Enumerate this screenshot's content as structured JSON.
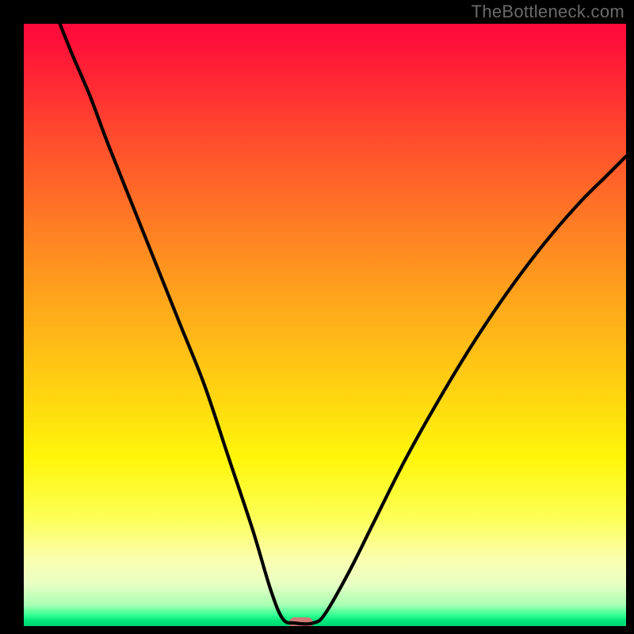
{
  "watermark": "TheBottleneck.com",
  "colors": {
    "frame": "#000000",
    "curve": "#000000",
    "marker": "#cf7a74",
    "gradient_stops": [
      {
        "pct": 0,
        "hex": "#ff0b3a"
      },
      {
        "pct": 3,
        "hex": "#ff1039"
      },
      {
        "pct": 18,
        "hex": "#ff482e"
      },
      {
        "pct": 32,
        "hex": "#ff7825"
      },
      {
        "pct": 45,
        "hex": "#ffa31c"
      },
      {
        "pct": 60,
        "hex": "#ffd012"
      },
      {
        "pct": 72,
        "hex": "#fff60a"
      },
      {
        "pct": 82,
        "hex": "#fdff56"
      },
      {
        "pct": 89,
        "hex": "#faffb0"
      },
      {
        "pct": 93,
        "hex": "#e9ffc3"
      },
      {
        "pct": 96.5,
        "hex": "#a8ffb3"
      },
      {
        "pct": 98.3,
        "hex": "#2cff90"
      },
      {
        "pct": 99.2,
        "hex": "#00e27a"
      },
      {
        "pct": 100,
        "hex": "#00d873"
      }
    ]
  },
  "chart_data": {
    "type": "line",
    "title": "",
    "xlabel": "",
    "ylabel": "",
    "x_range": [
      0,
      100
    ],
    "y_range": [
      0,
      100
    ],
    "marker": {
      "x": 46,
      "y": 0.5
    },
    "series": [
      {
        "name": "bottleneck-curve",
        "points": [
          {
            "x": 6,
            "y": 100
          },
          {
            "x": 8,
            "y": 95
          },
          {
            "x": 11,
            "y": 88
          },
          {
            "x": 14,
            "y": 80
          },
          {
            "x": 18,
            "y": 70
          },
          {
            "x": 22,
            "y": 60
          },
          {
            "x": 26,
            "y": 50
          },
          {
            "x": 30,
            "y": 40
          },
          {
            "x": 34,
            "y": 28
          },
          {
            "x": 38,
            "y": 16
          },
          {
            "x": 41,
            "y": 6
          },
          {
            "x": 43,
            "y": 1.2
          },
          {
            "x": 45,
            "y": 0.5
          },
          {
            "x": 48,
            "y": 0.5
          },
          {
            "x": 50,
            "y": 2
          },
          {
            "x": 54,
            "y": 9
          },
          {
            "x": 58,
            "y": 17
          },
          {
            "x": 63,
            "y": 27
          },
          {
            "x": 68,
            "y": 36
          },
          {
            "x": 74,
            "y": 46
          },
          {
            "x": 80,
            "y": 55
          },
          {
            "x": 86,
            "y": 63
          },
          {
            "x": 92,
            "y": 70
          },
          {
            "x": 97,
            "y": 75
          },
          {
            "x": 100,
            "y": 78
          }
        ]
      }
    ]
  }
}
